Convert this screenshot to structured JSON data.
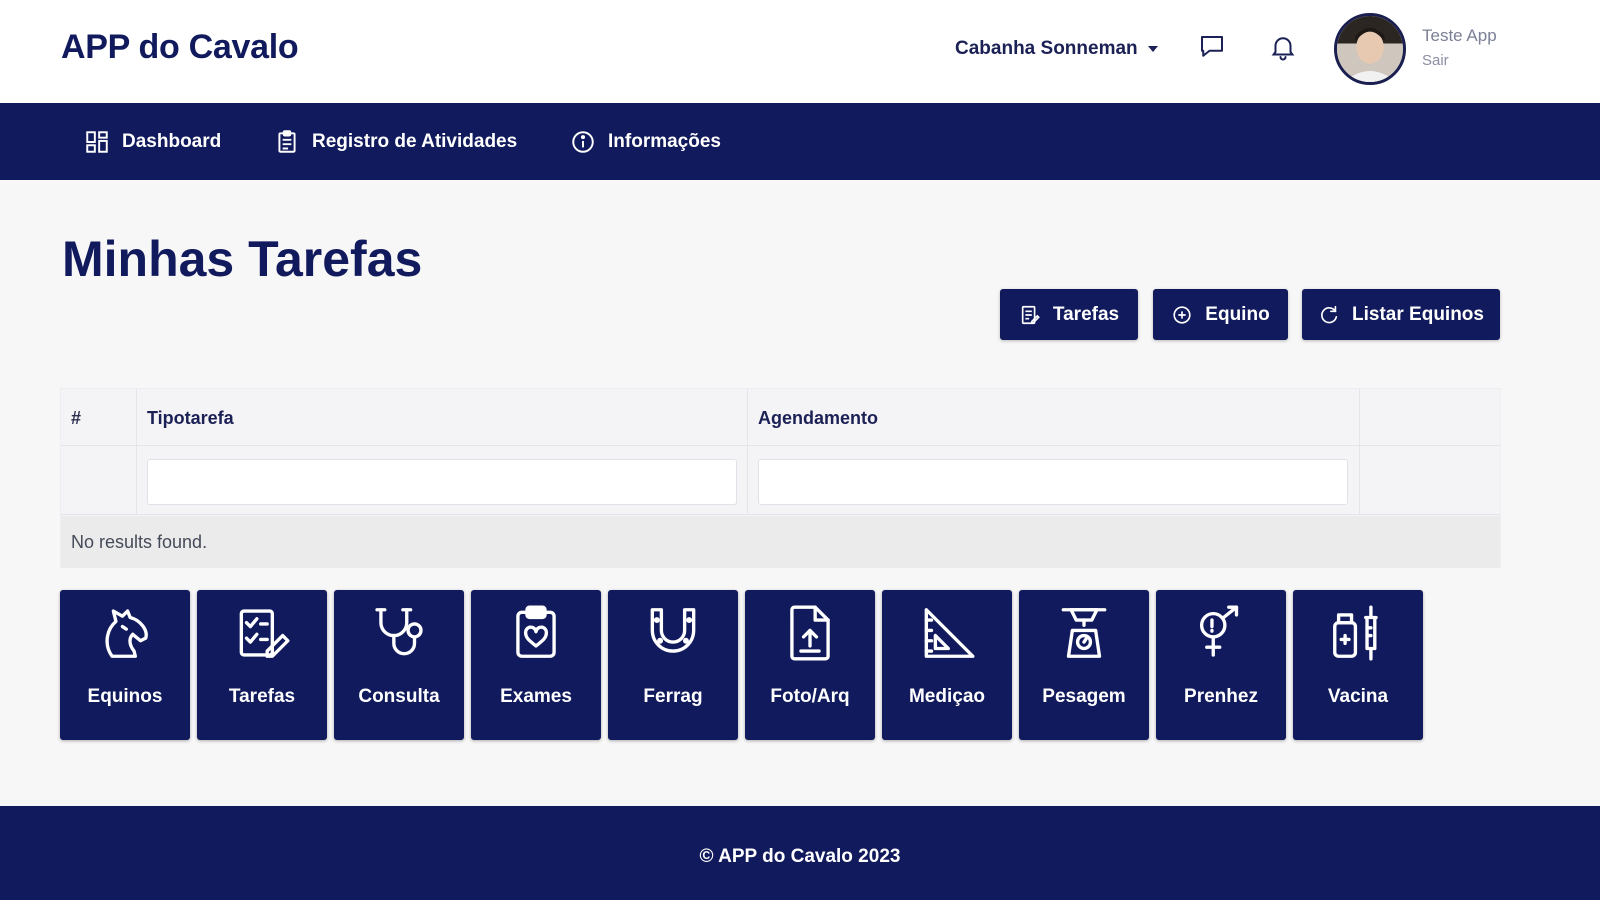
{
  "header": {
    "brand": "APP do Cavalo",
    "farm_selector": "Cabanha Sonneman",
    "user_name": "Teste App",
    "logout_label": "Sair"
  },
  "nav": {
    "items": [
      {
        "label": "Dashboard",
        "icon": "dashboard-icon"
      },
      {
        "label": "Registro de Atividades",
        "icon": "clipboard-icon"
      },
      {
        "label": "Informações",
        "icon": "info-icon"
      }
    ]
  },
  "main": {
    "title": "Minhas Tarefas",
    "actions": [
      {
        "label": "Tarefas",
        "icon": "edit-list-icon"
      },
      {
        "label": "Equino",
        "icon": "plus-circle-icon"
      },
      {
        "label": "Listar Equinos",
        "icon": "refresh-icon"
      }
    ],
    "grid": {
      "columns": [
        "#",
        "Tipotarefa",
        "Agendamento"
      ],
      "filters": {
        "tipotarefa": "",
        "agendamento": ""
      },
      "empty_message": "No results found."
    },
    "tiles": [
      {
        "label": "Equinos",
        "icon": "horse-icon"
      },
      {
        "label": "Tarefas",
        "icon": "checklist-icon"
      },
      {
        "label": "Consulta",
        "icon": "stethoscope-icon"
      },
      {
        "label": "Exames",
        "icon": "clipboard-heart-icon"
      },
      {
        "label": "Ferrag",
        "icon": "horseshoe-icon"
      },
      {
        "label": "Foto/Arq",
        "icon": "file-upload-icon"
      },
      {
        "label": "Mediçao",
        "icon": "ruler-triangle-icon"
      },
      {
        "label": "Pesagem",
        "icon": "scale-icon"
      },
      {
        "label": "Prenhez",
        "icon": "gender-icon"
      },
      {
        "label": "Vacina",
        "icon": "vaccine-icon"
      }
    ]
  },
  "footer": {
    "text": "© APP do Cavalo 2023"
  },
  "colors": {
    "primary": "#111a5c",
    "background": "#f7f7f8",
    "header_bg": "#ffffff"
  }
}
